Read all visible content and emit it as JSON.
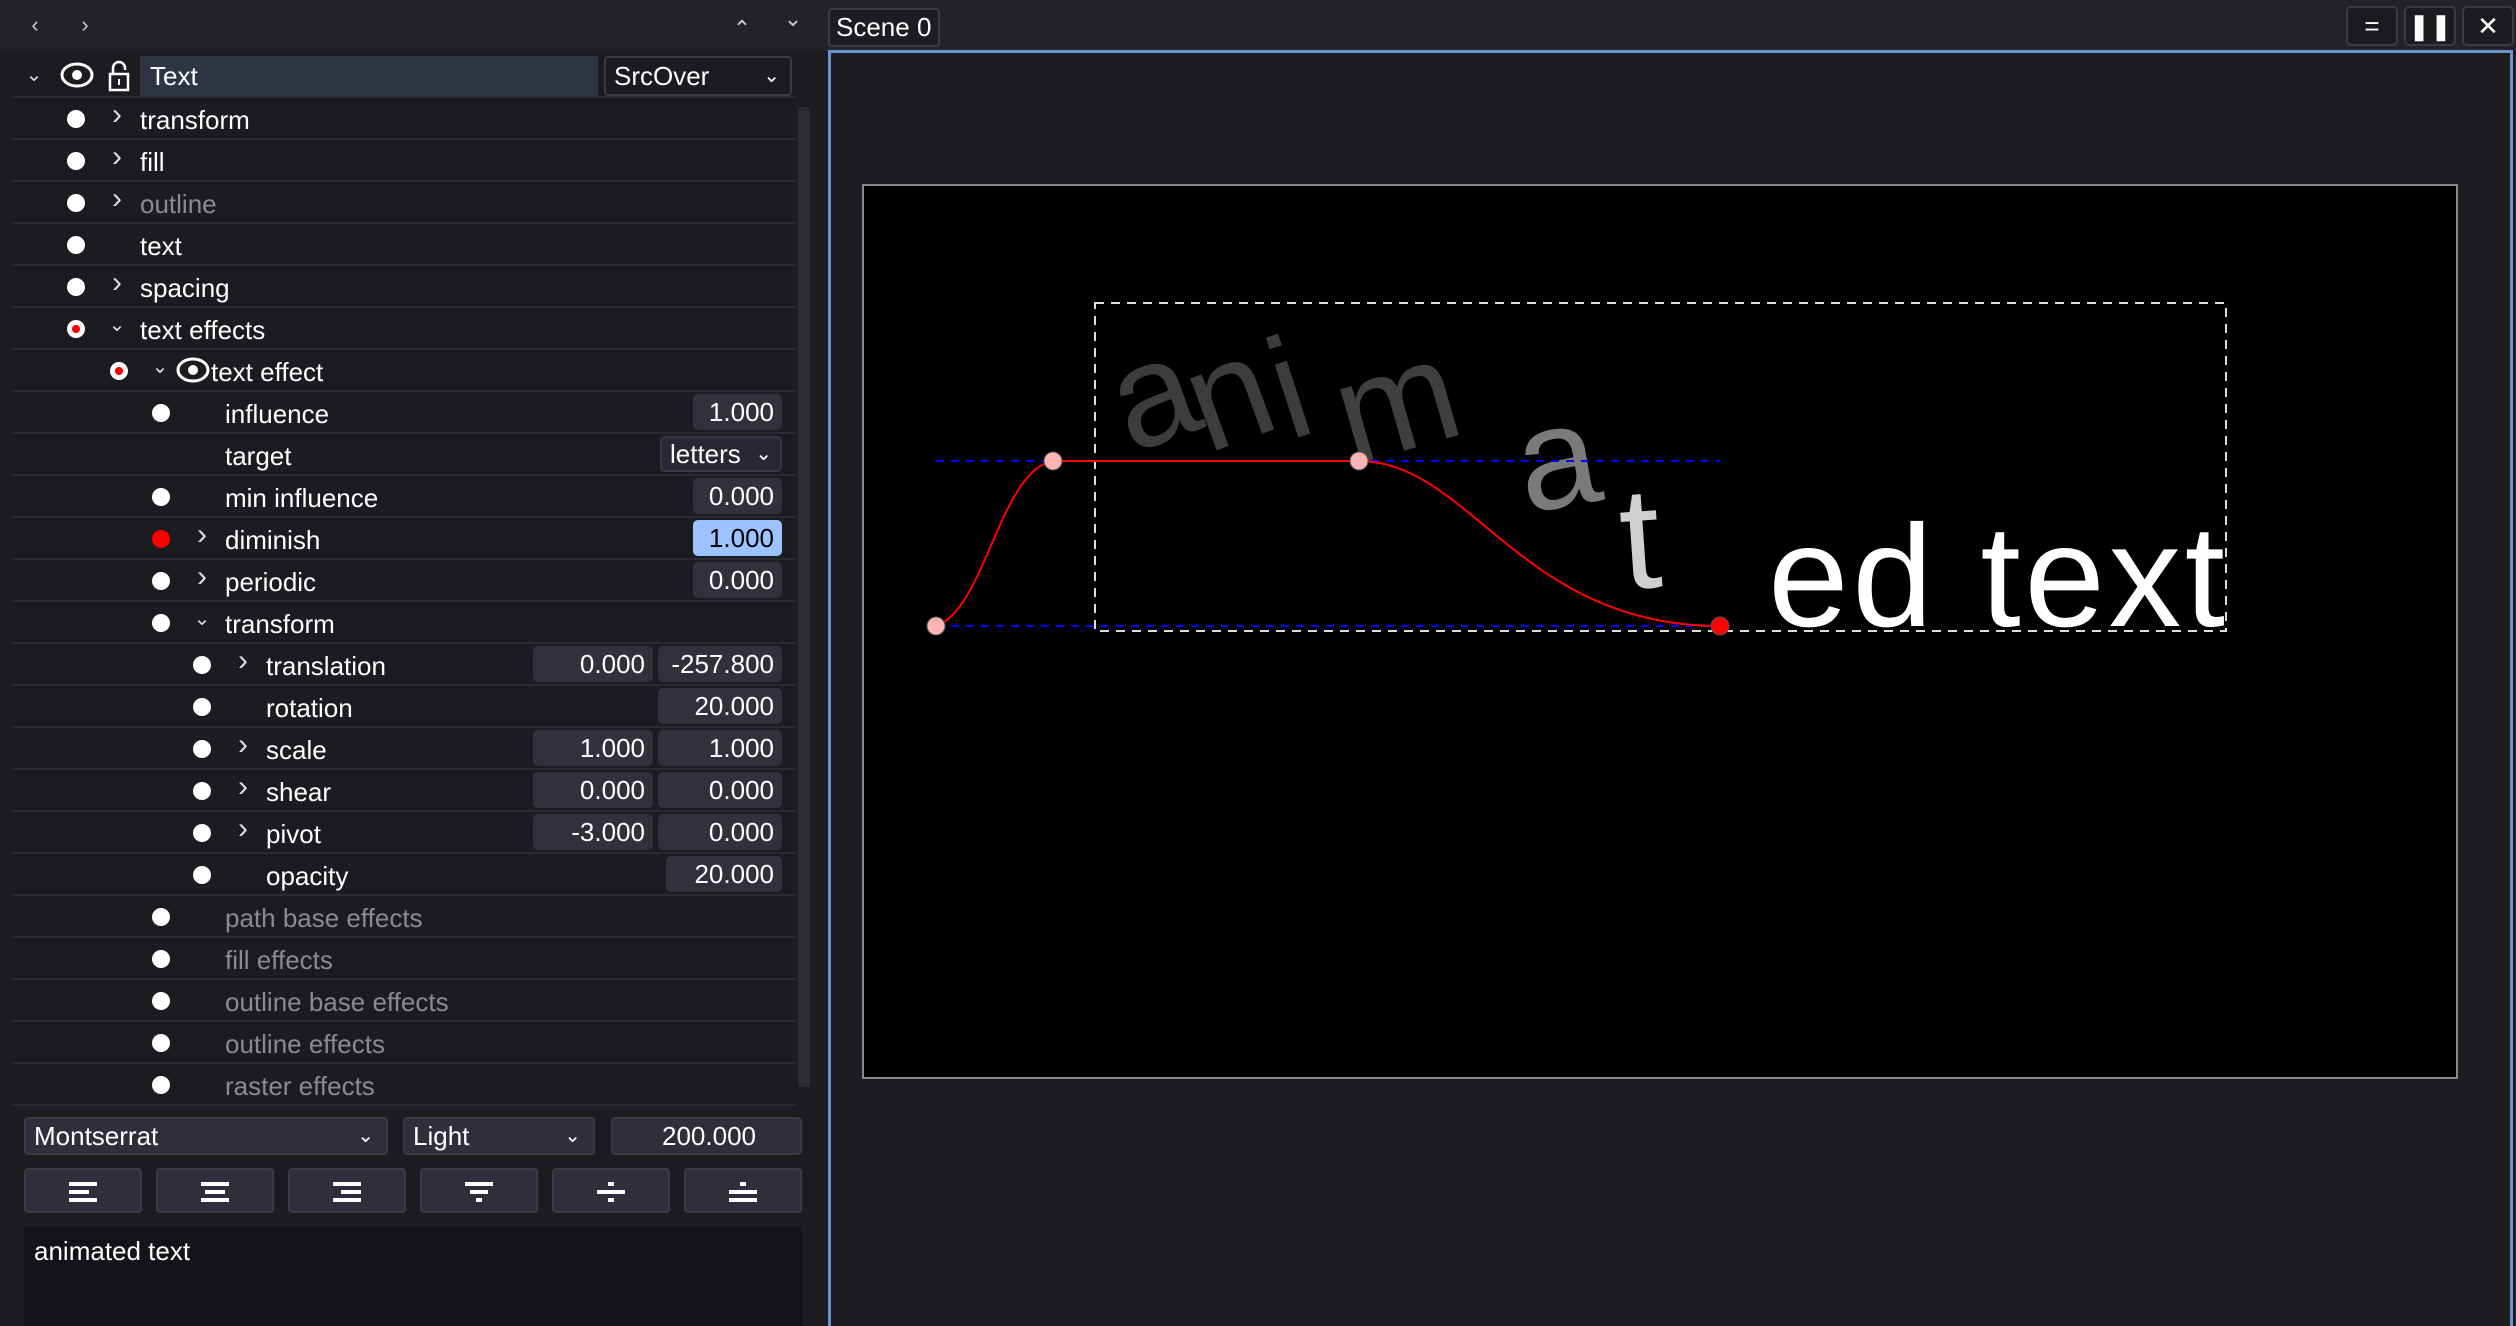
{
  "nav": {
    "back": "‹",
    "forward": "›",
    "up": "⌃",
    "down": "⌄"
  },
  "layer": {
    "name": "Text",
    "blend_mode": "SrcOver",
    "visible": true,
    "locked": false
  },
  "rows": [
    {
      "label": "transform",
      "level": 0,
      "dot": "white",
      "chevron": "right"
    },
    {
      "label": "fill",
      "level": 0,
      "dot": "white",
      "chevron": "right"
    },
    {
      "label": "outline",
      "level": 0,
      "dot": "white",
      "chevron": "right",
      "dim": true
    },
    {
      "label": "text",
      "level": 0,
      "dot": "white"
    },
    {
      "label": "spacing",
      "level": 0,
      "dot": "white",
      "chevron": "right"
    },
    {
      "label": "text effects",
      "level": 0,
      "dot": "ring",
      "chevron": "down"
    },
    {
      "label": "text effect",
      "level": 1,
      "dot": "ring",
      "chevron": "down",
      "eye": true
    },
    {
      "label": "influence",
      "level": 2,
      "dot": "white",
      "values": [
        "1.000"
      ]
    },
    {
      "label": "target",
      "level": 2,
      "dropdown": "letters"
    },
    {
      "label": "min influence",
      "level": 2,
      "dot": "white",
      "values": [
        "0.000"
      ]
    },
    {
      "label": "diminish",
      "level": 2,
      "dot": "red",
      "chevron": "right",
      "values": [
        "1.000"
      ],
      "highlight": true
    },
    {
      "label": "periodic",
      "level": 2,
      "dot": "white",
      "chevron": "right",
      "values": [
        "0.000"
      ]
    },
    {
      "label": "transform",
      "level": 2,
      "dot": "white",
      "chevron": "down"
    },
    {
      "label": "translation",
      "level": 3,
      "dot": "white",
      "chevron": "right",
      "values": [
        "0.000",
        "-257.800"
      ]
    },
    {
      "label": "rotation",
      "level": 3,
      "dot": "white",
      "values": [
        "20.000"
      ],
      "wide": true
    },
    {
      "label": "scale",
      "level": 3,
      "dot": "white",
      "chevron": "right",
      "values": [
        "1.000",
        "1.000"
      ]
    },
    {
      "label": "shear",
      "level": 3,
      "dot": "white",
      "chevron": "right",
      "values": [
        "0.000",
        "0.000"
      ]
    },
    {
      "label": "pivot",
      "level": 3,
      "dot": "white",
      "chevron": "right",
      "values": [
        "-3.000",
        "0.000"
      ]
    },
    {
      "label": "opacity",
      "level": 3,
      "dot": "white",
      "values": [
        "20.000"
      ],
      "wide": true
    },
    {
      "label": "path base effects",
      "level": 2,
      "dot": "white",
      "dim": true
    },
    {
      "label": "fill effects",
      "level": 2,
      "dot": "white",
      "dim": true
    },
    {
      "label": "outline base effects",
      "level": 2,
      "dot": "white",
      "dim": true
    },
    {
      "label": "outline effects",
      "level": 2,
      "dot": "white",
      "dim": true
    },
    {
      "label": "raster effects",
      "level": 2,
      "dot": "white",
      "dim": true
    }
  ],
  "font": {
    "family": "Montserrat",
    "style": "Light",
    "size": "200.000"
  },
  "align_buttons": [
    "align-left-icon",
    "align-center-icon",
    "align-right-icon",
    "align-top-icon",
    "align-middle-icon",
    "align-bottom-icon"
  ],
  "text_editor": {
    "value": "animated text"
  },
  "scene": {
    "tab": "Scene 0",
    "buttons": [
      "equals-icon",
      "pause-icon",
      "close-icon"
    ]
  },
  "colors": {
    "accent": "#6a93cf",
    "highlight": "#9cc3ff",
    "curve": "#ff0000",
    "handle": "#ffb3b3",
    "guide": "#0000ff"
  }
}
